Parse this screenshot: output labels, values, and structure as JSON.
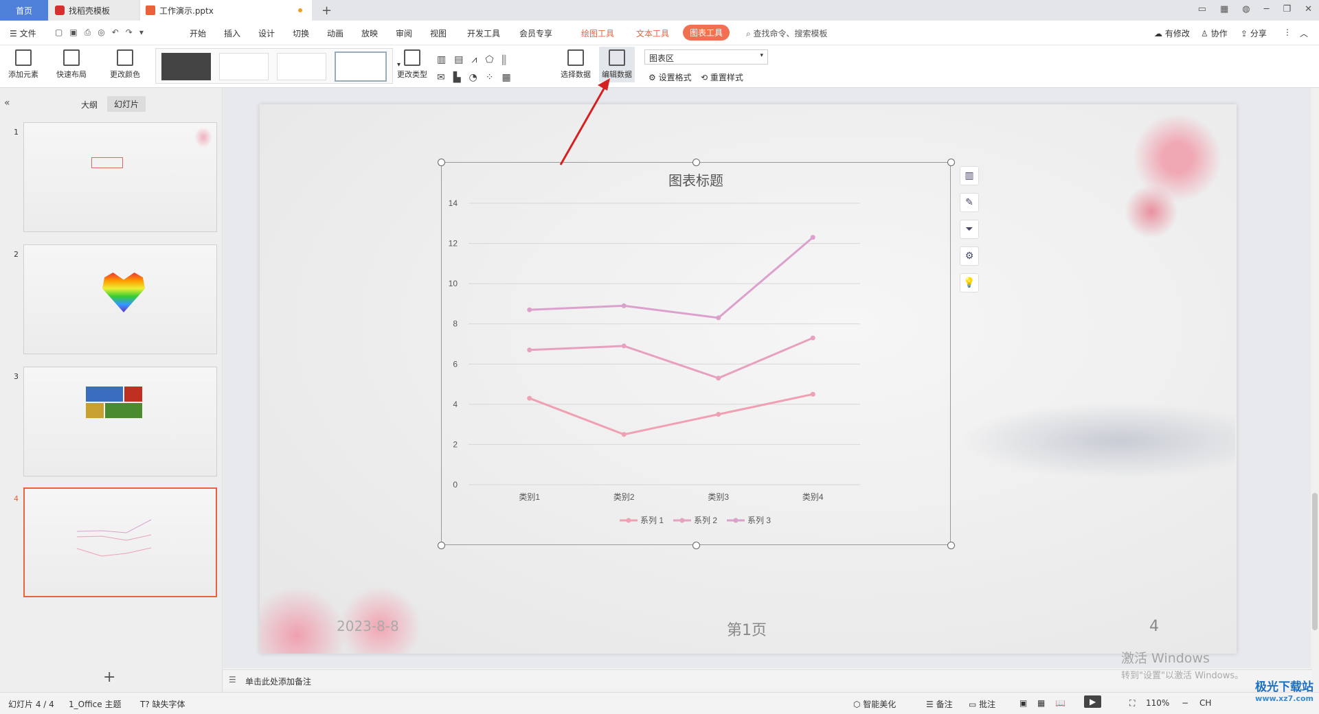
{
  "tabs": {
    "home": "首页",
    "template": "找稻壳模板",
    "document": "工作演示.pptx",
    "new_tab": "+"
  },
  "menu": {
    "file": "文件",
    "items": [
      "开始",
      "插入",
      "设计",
      "切换",
      "动画",
      "放映",
      "审阅",
      "视图",
      "开发工具",
      "会员专享"
    ],
    "ctx_drawing": "绘图工具",
    "ctx_text": "文本工具",
    "ctx_chart": "图表工具",
    "search": "查找命令、搜索模板",
    "changes": "有修改",
    "collab": "协作",
    "share": "分享"
  },
  "ribbon": {
    "add_element": "添加元素",
    "quick_layout": "快速布局",
    "change_color": "更改颜色",
    "change_type": "更改类型",
    "select_data": "选择数据",
    "edit_data": "编辑数据",
    "chart_area": "图表区",
    "set_format": "设置格式",
    "reset_style": "重置样式"
  },
  "left_panel": {
    "outline": "大纲",
    "slides": "幻灯片",
    "slide_numbers": [
      "1",
      "2",
      "3",
      "4"
    ],
    "add": "+"
  },
  "chart_data": {
    "type": "line",
    "title": "图表标题",
    "categories": [
      "类别1",
      "类别2",
      "类别3",
      "类别4"
    ],
    "series": [
      {
        "name": "系列 1",
        "values": [
          4.3,
          2.5,
          3.5,
          4.5
        ],
        "color": "#f0a0b2"
      },
      {
        "name": "系列 2",
        "values": [
          6.7,
          6.9,
          5.3,
          7.3
        ],
        "color": "#e8a0bf"
      },
      {
        "name": "系列 3",
        "values": [
          8.7,
          8.9,
          8.3,
          12.3
        ],
        "color": "#dca0cc"
      }
    ],
    "yticks": [
      "0",
      "2",
      "4",
      "6",
      "8",
      "10",
      "12",
      "14"
    ],
    "ylim": [
      0,
      14
    ],
    "grid": true,
    "legend": "bottom"
  },
  "slide": {
    "date": "2023-8-8",
    "page_label": "第1页",
    "page_number": "4"
  },
  "notes": {
    "placeholder": "单击此处添加备注"
  },
  "status": {
    "slide_count": "幻灯片 4 / 4",
    "theme": "1_Office 主题",
    "missing_font": "缺失字体",
    "beautify": "智能美化",
    "notes": "备注",
    "comments": "批注",
    "zoom": "110%",
    "lang": "CH"
  },
  "watermark": {
    "line1": "激活 Windows",
    "line2": "转到\"设置\"以激活 Windows。",
    "site": "极光下载站",
    "url": "www.xz7.com"
  },
  "colors": {
    "accent": "#e8623a",
    "chart_tab": "#f07050",
    "arrow": "#d42020"
  }
}
